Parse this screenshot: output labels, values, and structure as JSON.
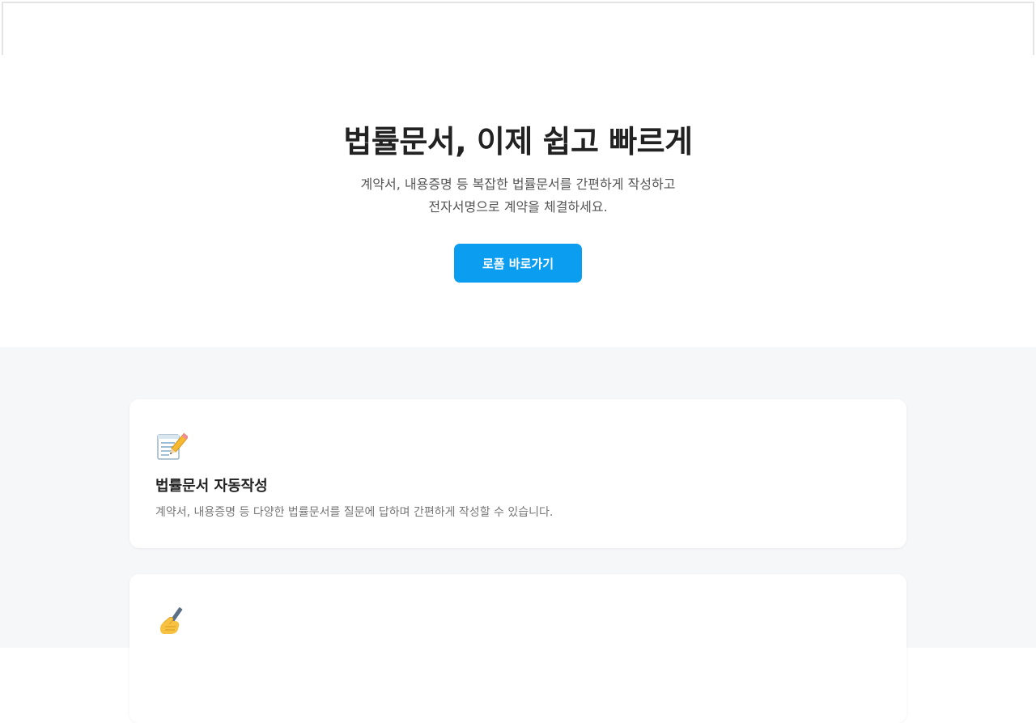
{
  "hero": {
    "title": "법률문서, 이제 쉽고 빠르게",
    "description_line1": "계약서, 내용증명 등 복잡한 법률문서를 간편하게 작성하고",
    "description_line2": "전자서명으로 계약을 체결하세요.",
    "cta_label": "로폼 바로가기"
  },
  "features": [
    {
      "icon": "memo-pencil-icon",
      "title": "법률문서 자동작성",
      "description": "계약서, 내용증명 등 다양한 법률문서를 질문에 답하며 간편하게 작성할 수 있습니다."
    },
    {
      "icon": "writing-hand-icon"
    }
  ],
  "colors": {
    "accent": "#0b9df0",
    "section_background": "#f6f7f9",
    "title_text": "#222222",
    "body_text": "#555555"
  }
}
